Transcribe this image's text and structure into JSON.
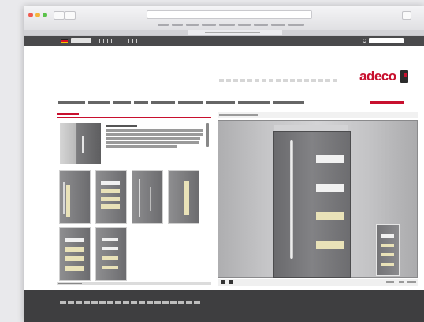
{
  "site": {
    "logo_text": "adeco"
  },
  "colors": {
    "brand_red": "#c8102e",
    "top_bar": "#4a4a4c",
    "footer": "#3e3e40"
  },
  "icons": {
    "logo": "adeco-door-logo-icon",
    "search": "search-icon",
    "language": "german-flag-icon"
  }
}
